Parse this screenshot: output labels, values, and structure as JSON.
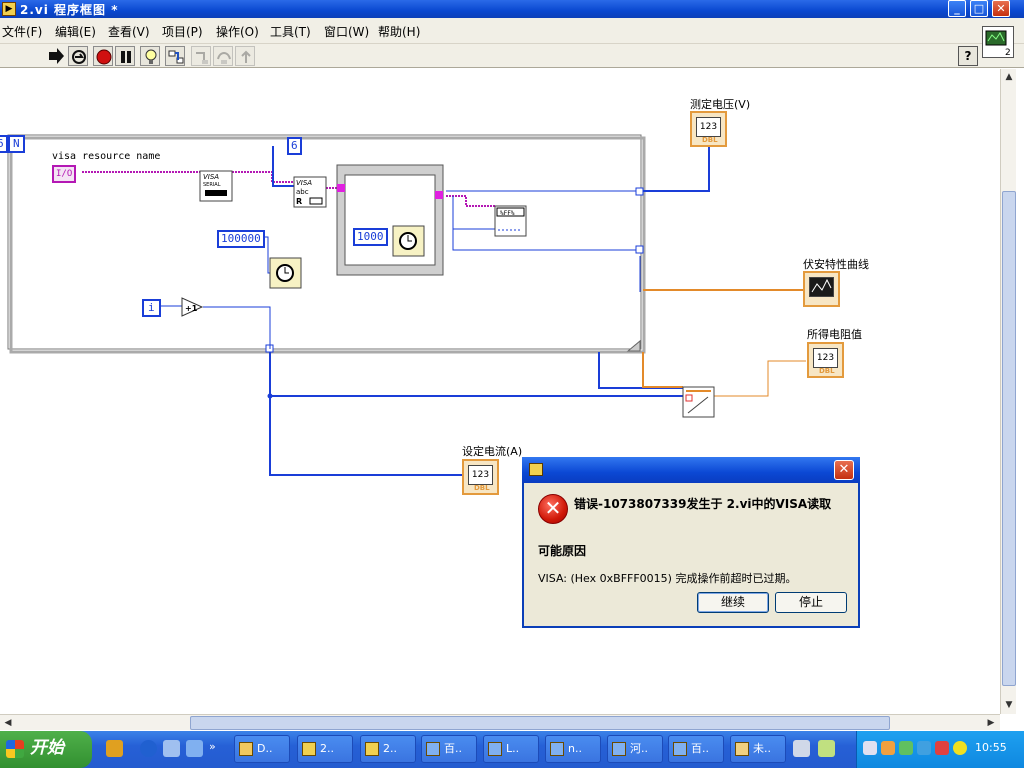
{
  "window": {
    "title": "2.vi 程序框图 *",
    "controls": {
      "minimize": "_",
      "maximize": "□",
      "close": "✕"
    }
  },
  "menu": [
    "文件(F)",
    "编辑(E)",
    "查看(V)",
    "项目(P)",
    "操作(O)",
    "工具(T)",
    "窗口(W)",
    "帮助(H)"
  ],
  "toolbar": {
    "buttons": [
      "run-arrow-icon",
      "run-continuous-icon",
      "abort-icon",
      "pause-icon",
      "highlight-execution-icon",
      "retain-wire-values-icon",
      "step-into-icon",
      "step-over-icon",
      "step-out-icon"
    ],
    "help": "?"
  },
  "diagram": {
    "loop_N": "N",
    "loop_N_left": "6",
    "loop_i": "i",
    "visa_resource_label": "visa resource name",
    "visa_resource_const": "I/O",
    "const_6": "6",
    "const_100000": "100000",
    "const_1000": "1000",
    "increment": "+1",
    "visa_serial": "VISA\nSERIAL",
    "visa_read": "VISA\nabc\nR",
    "indicators": {
      "measured_voltage": {
        "label": "测定电压(V)",
        "value": "123",
        "type": "DBL"
      },
      "va_curve": {
        "label": "伏安特性曲线"
      },
      "resistance": {
        "label": "所得电阻值",
        "value": "123",
        "type": "DBL"
      },
      "set_current": {
        "label": "设定电流(A)",
        "value": "123",
        "type": "DBL"
      }
    }
  },
  "dialog": {
    "heading": "错误-1073807339发生于 2.vi中的VISA读取",
    "subheading": "可能原因",
    "message": "VISA:  (Hex 0xBFFF0015) 完成操作前超时已过期。",
    "continue_label": "继续",
    "stop_label": "停止",
    "close": "✕"
  },
  "taskbar": {
    "start_label": "开始",
    "tasks": [
      "D..",
      "2..",
      "2..",
      "百..",
      "L..",
      "n..",
      "河..",
      "百..",
      "未.."
    ],
    "clock": "10:55"
  },
  "colors": {
    "wire_blue": "#1a3ed8",
    "wire_orange": "#e38a2a",
    "wire_pink": "#b418b4",
    "titlebar": "#0b48d0"
  }
}
